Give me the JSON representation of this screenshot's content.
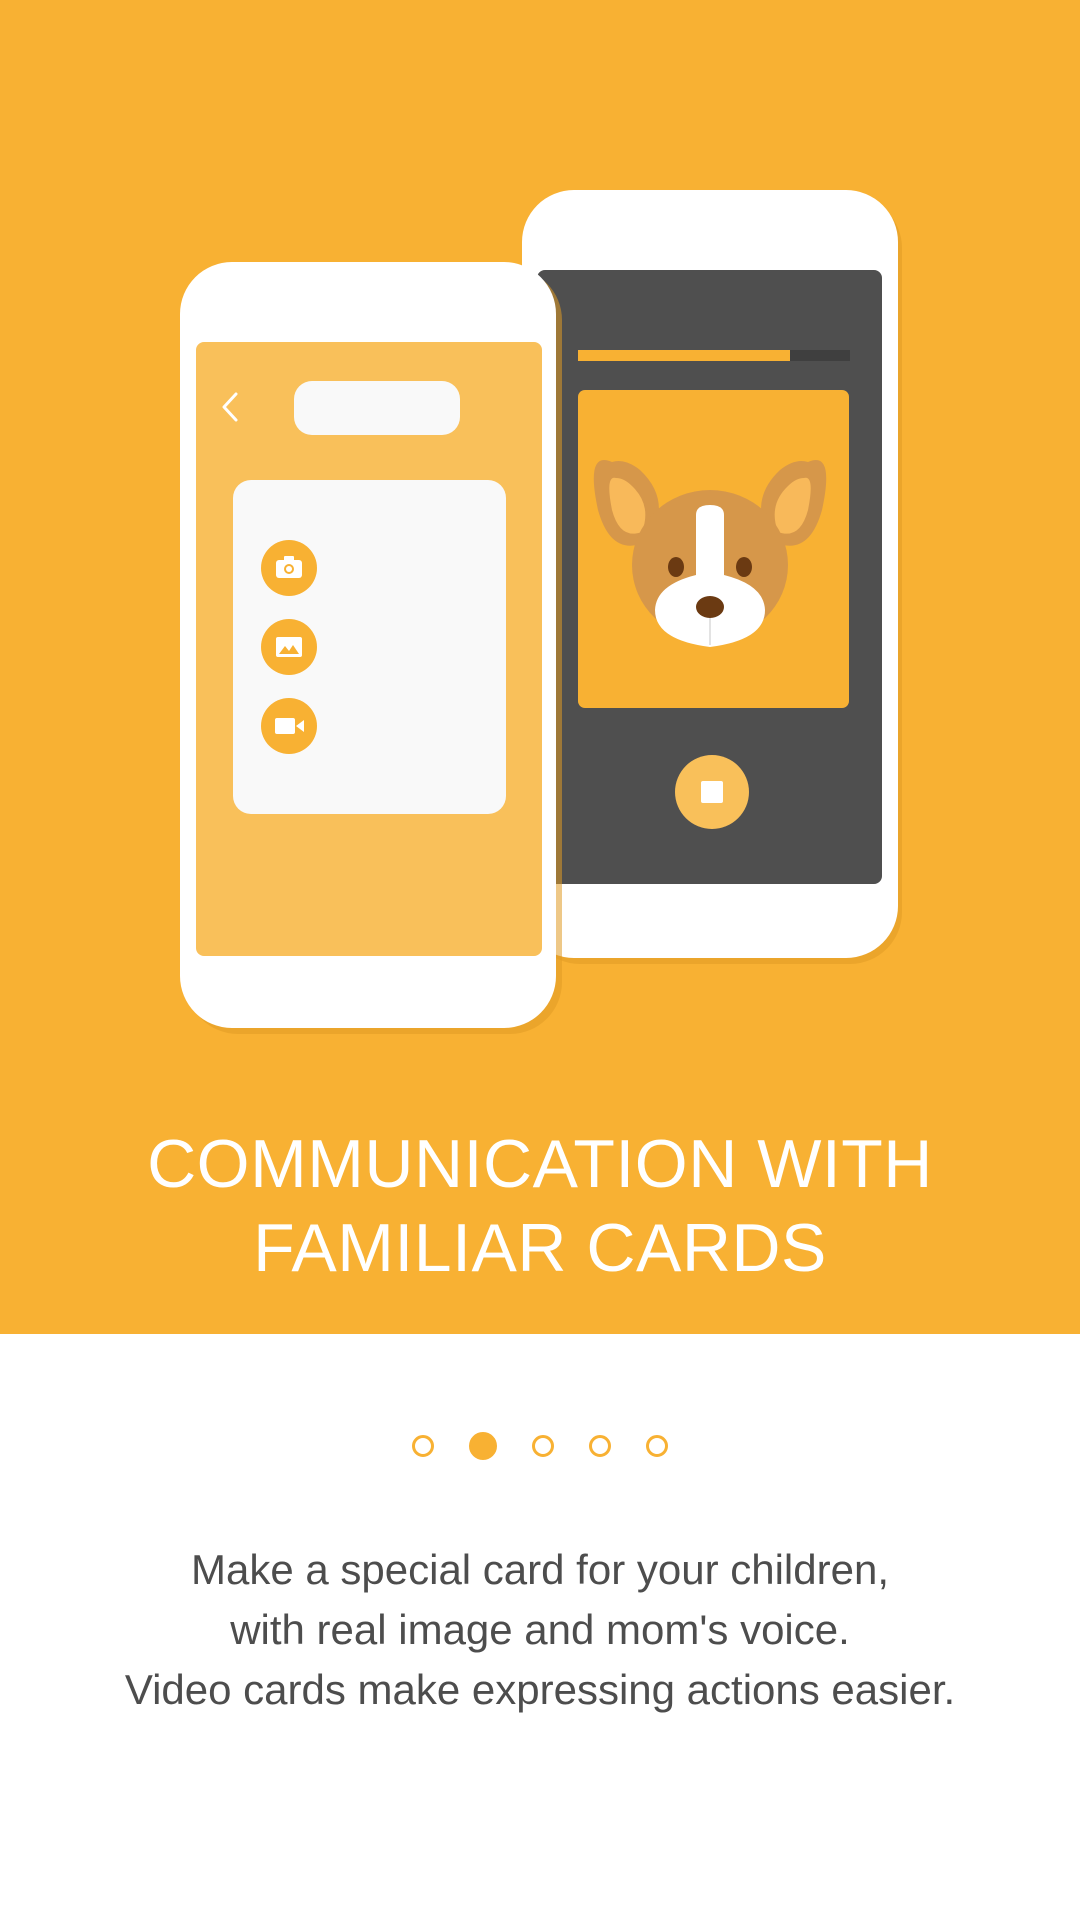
{
  "hero": {
    "title_line1": "COMMUNICATION WITH",
    "title_line2": "FAMILIAR CARDS",
    "background_color": "#F8B133"
  },
  "illustration": {
    "left_phone": {
      "icons": [
        "back-chevron-icon",
        "camera-icon",
        "image-icon",
        "video-icon"
      ]
    },
    "right_phone": {
      "progress": 0.78,
      "card_subject": "dog-illustration",
      "icons": [
        "stop-icon"
      ]
    }
  },
  "pager": {
    "total": 5,
    "active_index": 1
  },
  "description": {
    "line1": "Make a special card for your children,",
    "line2": "with real image and mom's voice.",
    "line3": "Video cards make expressing actions easier."
  },
  "colors": {
    "accent": "#F8B133",
    "phone_dark_screen": "#4F4F4F",
    "phone_light_screen": "#F9C05A",
    "text_dark": "#4d4d4d"
  }
}
